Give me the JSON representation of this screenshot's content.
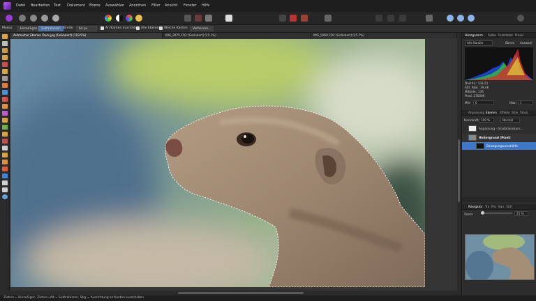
{
  "menu": {
    "items": [
      "Datei",
      "Bearbeiten",
      "Text",
      "Dokument",
      "Ebene",
      "Auswählen",
      "Anordnen",
      "Filter",
      "Ansicht",
      "Fenster",
      "Hilfe"
    ]
  },
  "context": {
    "mode_label": "Modus",
    "add_label": "Hinzufügen",
    "subtract_label": "Subtrahieren",
    "width_label": "Breite",
    "width_value": "64 px",
    "snap_edges_label": "An Kanten ausrichten",
    "all_layers_label": "Alle Ebenen",
    "soft_edges_label": "Weiche Kanten",
    "refine_label": "Verfeinern..."
  },
  "tabs": [
    {
      "label": "Aufmacher Ebenen Deck.jpg [Geändert] (119.5%)",
      "active": true
    },
    {
      "label": "IMG_2875.CR2 [Geändert] (25.1%)",
      "active": false
    },
    {
      "label": "IMG_5960.CR2 [Geändert] (25.7%)",
      "active": false
    }
  ],
  "histogram_panel": {
    "tabs": [
      "Histogramm",
      "Farbe",
      "Farbfelder",
      "Pinsel"
    ],
    "channel": "Alle Kanäle",
    "layer_label": "Ebene",
    "selection_label": "Auswahl",
    "stats": [
      "Durchs.: 133,51",
      "Std. Abw.: 39,46",
      "Mittelw.: 135",
      "Pixel: 376009"
    ],
    "min_label": "Min:",
    "min_value": "0",
    "max_label": "Max:",
    "max_value": "1"
  },
  "layers_panel": {
    "tabs": [
      "Anpassung",
      "Ebenen",
      "Effekte",
      "Stile",
      "Stock"
    ],
    "opacity_label": "Deckkraft:",
    "opacity_value": "100 %",
    "blend_mode": "Normal",
    "layers": [
      {
        "name": "Anpassung - Gradationskurv...",
        "selected": false
      },
      {
        "name": "Hintergrund (Pixel)",
        "selected": false
      },
      {
        "name": "Bewegungsunschärfe",
        "selected": true
      }
    ]
  },
  "navigator_panel": {
    "tabs": [
      "Navigator",
      "Tra",
      "Pro",
      "Kan",
      "32X"
    ],
    "zoom_label": "Zoom:",
    "zoom_value": "25 %"
  },
  "status": {
    "text": "Ziehen = Hinzufügen, Ziehen+Alt = Subtrahieren, Strg = Ausrichtung an Kanten ausschalten."
  },
  "colors": {
    "accent": "#4d6e9a",
    "selected_layer": "#3f78c8",
    "app_logo": "#9b3bd8"
  }
}
